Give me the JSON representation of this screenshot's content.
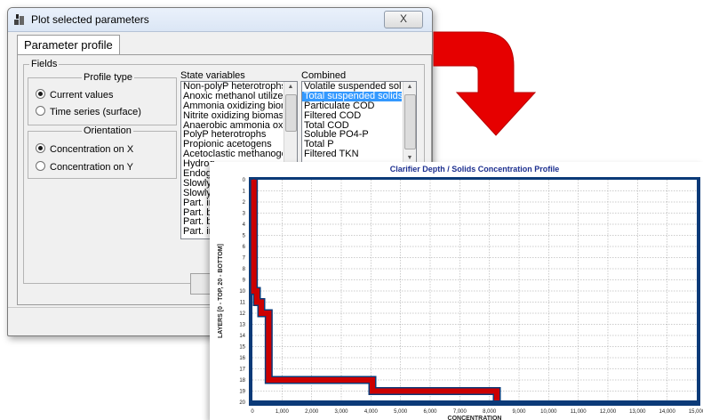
{
  "window": {
    "title": "Plot selected parameters",
    "close_label": "X",
    "tab_label": "Parameter profile"
  },
  "fields": {
    "label": "Fields",
    "profile_type": {
      "label": "Profile type",
      "options": [
        "Current values",
        "Time series (surface)"
      ],
      "selected": "Current values"
    },
    "orientation": {
      "label": "Orientation",
      "options": [
        "Concentration on X",
        "Concentration on Y"
      ],
      "selected": "Concentration on X"
    },
    "state_variables": {
      "label": "State variables",
      "items": [
        "Non-polyP heterotrophs",
        "Anoxic methanol utilizers",
        "Ammonia oxidizing biomass",
        "Nitrite oxidizing biomass",
        "Anaerobic ammonia oxidize",
        "PolyP heterotrophs",
        "Propionic acetogens",
        "Acetoclastic methanogens",
        "Hydrog",
        "Endoge",
        "Slowly",
        "Slowly",
        "Part. in",
        "Part. bi",
        "Part. bi",
        "Part. in"
      ]
    },
    "combined": {
      "label": "Combined",
      "items": [
        "Volatile suspended solids",
        "Total suspended solids",
        "Particulate COD",
        "Filtered COD",
        "Total COD",
        "Soluble PO4-P",
        "Total P",
        "Filtered TKN"
      ],
      "selected": "Total suspended solids"
    }
  },
  "chart_data": {
    "type": "line",
    "title": "Clarifier Depth / Solids Concentration Profile",
    "xlabel": "CONCENTRATION",
    "ylabel": "LAYERS [0 - TOP, 20 - BOTTOM]",
    "xlim": [
      0,
      15000
    ],
    "ylim": [
      0,
      20
    ],
    "y_inverted": true,
    "grid": true,
    "x_ticks": [
      "0",
      "1,000",
      "2,000",
      "3,000",
      "4,000",
      "5,000",
      "6,000",
      "7,000",
      "8,000",
      "9,000",
      "10,000",
      "11,000",
      "12,000",
      "13,000",
      "14,000",
      "15,000"
    ],
    "y_ticks": [
      "0",
      "1",
      "2",
      "3",
      "4",
      "5",
      "6",
      "7",
      "8",
      "9",
      "10",
      "11",
      "12",
      "13",
      "14",
      "15",
      "16",
      "17",
      "18",
      "19",
      "20"
    ],
    "series": [
      {
        "color": "#cc0000",
        "points": [
          {
            "layer": 0,
            "value": 50
          },
          {
            "layer": 10,
            "value": 150
          },
          {
            "layer": 11,
            "value": 300
          },
          {
            "layer": 12,
            "value": 550
          },
          {
            "layer": 17,
            "value": 550
          },
          {
            "layer": 18,
            "value": 4050
          },
          {
            "layer": 19,
            "value": 8250
          },
          {
            "layer": 20,
            "value": 8250
          }
        ]
      }
    ],
    "border_color": "#0b3a78"
  }
}
